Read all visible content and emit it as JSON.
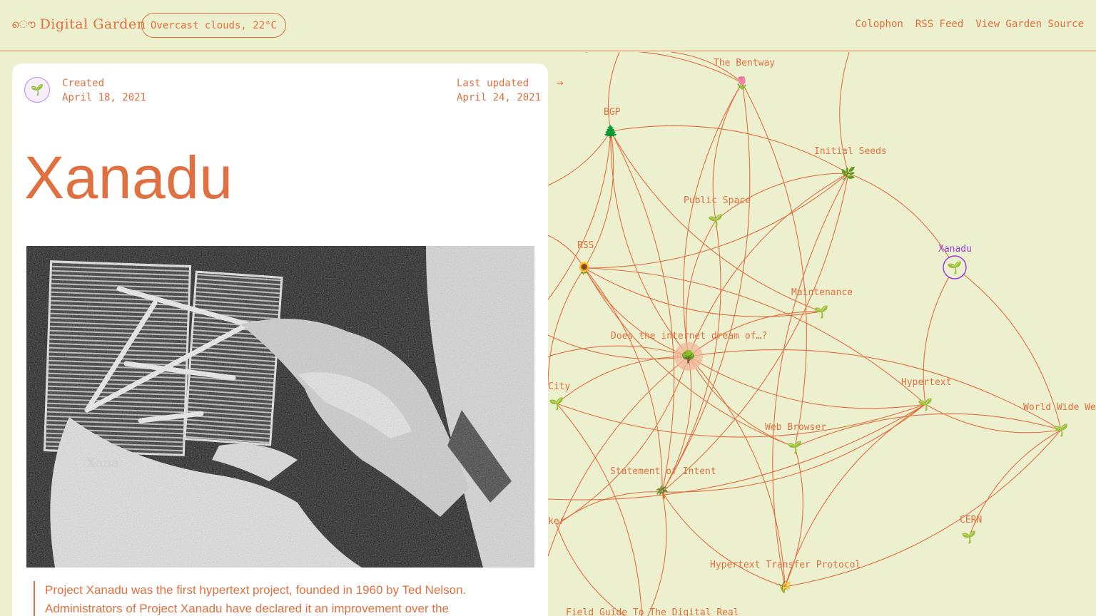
{
  "header": {
    "logo_icon": "ൌ",
    "logo_text": "Digital Garden",
    "weather": "Overcast clouds, 22°C",
    "nav": [
      "Colophon",
      "RSS Feed",
      "View Garden Source"
    ]
  },
  "note": {
    "avatar_icon": "🌱",
    "created_label": "Created",
    "created_date": "April 18, 2021",
    "updated_label": "Last updated",
    "updated_date": "April 24, 2021",
    "title": "Xanadu",
    "photo_caption_text": "Xana",
    "quote": "Project Xanadu was the first hypertext project, founded in 1960 by Ted Nelson. Administrators of Project Xanadu have declared it an improvement over the",
    "arrow": "→"
  },
  "graph": {
    "colors": {
      "edge": "#e0703f",
      "label": "#e0703f",
      "active": "#9a3ce0",
      "highlight": "#f3b79a"
    },
    "nodes": [
      {
        "id": "bentway",
        "label": "The Bentway",
        "icon": "🌷"
      },
      {
        "id": "bgp",
        "label": "BGP",
        "icon": "🌲"
      },
      {
        "id": "seeds",
        "label": "Initial Seeds",
        "icon": "🌿"
      },
      {
        "id": "public",
        "label": "Public Space",
        "icon": "🌱"
      },
      {
        "id": "rss",
        "label": "RSS",
        "icon": "🌻"
      },
      {
        "id": "xanadu",
        "label": "Xanadu",
        "icon": "🌱",
        "active": true
      },
      {
        "id": "maint",
        "label": "Maintenance",
        "icon": "🌱"
      },
      {
        "id": "dream",
        "label": "Does the internet dream of…?",
        "icon": "🌳",
        "highlight": true
      },
      {
        "id": "city",
        "label": "City",
        "icon": "🌱"
      },
      {
        "id": "hypertext",
        "label": "Hypertext",
        "icon": "🌱"
      },
      {
        "id": "www",
        "label": "World Wide We",
        "icon": "🌱"
      },
      {
        "id": "browser",
        "label": "Web Browser",
        "icon": "🌱"
      },
      {
        "id": "statement",
        "label": "Statement of Intent",
        "icon": "🌴"
      },
      {
        "id": "ker",
        "label": "ker",
        "icon": ""
      },
      {
        "id": "cern",
        "label": "CERN",
        "icon": "🌱"
      },
      {
        "id": "http",
        "label": "Hypertext Transfer Protocol",
        "icon": "🌾"
      },
      {
        "id": "field",
        "label": "Field Guide To The Digital Real",
        "icon": ""
      }
    ]
  }
}
